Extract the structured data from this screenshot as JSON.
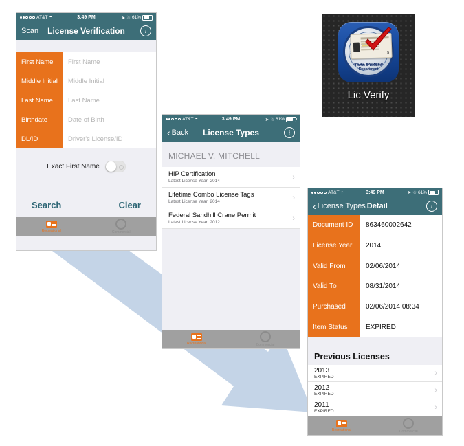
{
  "status_bar": {
    "carrier": "AT&T",
    "time": "3:49 PM",
    "battery": "61%"
  },
  "phone1": {
    "nav": {
      "left_label": "Scan",
      "title": "License Verification",
      "info_icon": "info-icon"
    },
    "fields": [
      {
        "label": "First Name",
        "placeholder": "First Name"
      },
      {
        "label": "Middle Initial",
        "placeholder": "Middle Initial"
      },
      {
        "label": "Last Name",
        "placeholder": "Last Name"
      },
      {
        "label": "Birthdate",
        "placeholder": "Date of Birth"
      },
      {
        "label": "DL/ID",
        "placeholder": "Driver's License/ID"
      }
    ],
    "toggle": {
      "label": "Exact First Name",
      "state": "off"
    },
    "buttons": {
      "search": "Search",
      "clear": "Clear"
    }
  },
  "phone2": {
    "nav": {
      "back_label": "Back",
      "title": "License Types",
      "info_icon": "info-icon"
    },
    "person_name": "MICHAEL V. MITCHELL",
    "rows": [
      {
        "title": "HIP Certification",
        "subtitle": "Latest License Year: 2014"
      },
      {
        "title": "Lifetime Combo License Tags",
        "subtitle": "Latest License Year: 2014"
      },
      {
        "title": "Federal Sandhill Crane Permit",
        "subtitle": "Latest License Year: 2012"
      }
    ]
  },
  "phone3": {
    "nav": {
      "back_label": "License Types",
      "title": "Detail",
      "info_icon": "info-icon"
    },
    "detail_rows": [
      {
        "label": "Document ID",
        "value": "863460002642"
      },
      {
        "label": "License Year",
        "value": "2014"
      },
      {
        "label": "Valid From",
        "value": "02/06/2014"
      },
      {
        "label": "Valid To",
        "value": "08/31/2014"
      },
      {
        "label": "Purchased",
        "value": "02/06/2014 08:34"
      },
      {
        "label": "Item Status",
        "value": "EXPIRED"
      }
    ],
    "previous_section_title": "Previous Licenses",
    "previous_rows": [
      {
        "year": "2013",
        "status": "EXPIRED"
      },
      {
        "year": "2012",
        "status": "EXPIRED"
      },
      {
        "year": "2011",
        "status": "EXPIRED"
      }
    ]
  },
  "tab_bar": {
    "recreational": "Recreational",
    "commercial": "Commercial"
  },
  "app_icon": {
    "label": "Lic Verify",
    "badge_text_top": "GAME WARDEN",
    "badge_text_bottom": "Parks & Wildlife Department",
    "card_number": "5"
  },
  "colors": {
    "nav_teal": "#3d6e78",
    "accent_orange": "#E8721C",
    "tab_bar_gray": "#a0a0a0",
    "arrow_blue": "#b7cbe2",
    "link_teal": "#2f6776"
  }
}
